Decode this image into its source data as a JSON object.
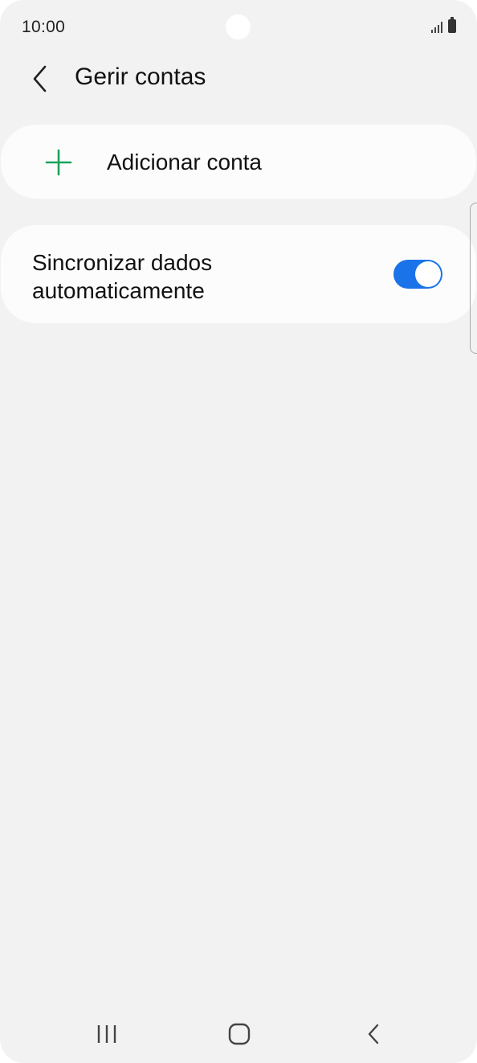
{
  "status_bar": {
    "time": "10:00",
    "icons": [
      "signal-icon",
      "battery-icon"
    ]
  },
  "header": {
    "title": "Gerir contas",
    "back_icon": "chevron-left-icon"
  },
  "add_account": {
    "label": "Adicionar conta",
    "icon": "plus-icon",
    "icon_color": "#1aa35a"
  },
  "sync": {
    "label": "Sincronizar dados automaticamente",
    "toggle_on": true,
    "toggle_color": "#1a73e8"
  },
  "nav_bar": {
    "buttons": [
      "recent-apps-icon",
      "home-icon",
      "back-icon"
    ]
  }
}
